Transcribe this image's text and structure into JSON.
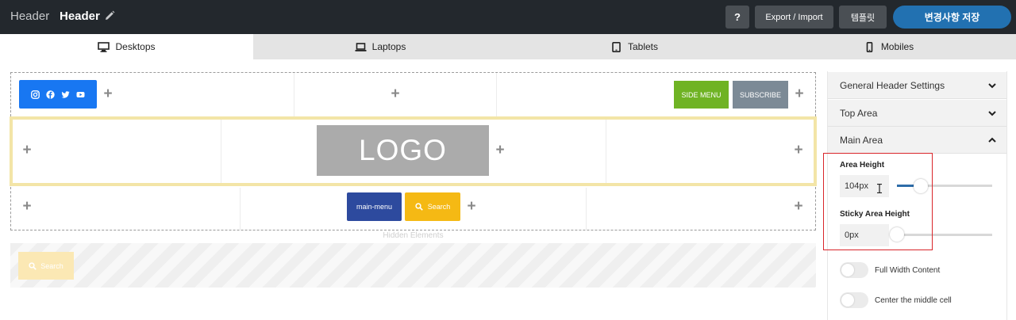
{
  "topbar": {
    "breadcrumb": "Header",
    "title": "Header",
    "help_label": "?",
    "export_label": "Export / Import",
    "template_label": "템플릿",
    "save_label": "변경사항 저장"
  },
  "device_tabs": [
    {
      "label": "Desktops",
      "icon": "desktop-icon",
      "active": true
    },
    {
      "label": "Laptops",
      "icon": "laptop-icon",
      "active": false
    },
    {
      "label": "Tablets",
      "icon": "tablet-icon",
      "active": false
    },
    {
      "label": "Mobiles",
      "icon": "mobile-icon",
      "active": false
    }
  ],
  "builder": {
    "top_row": {
      "social_icons": [
        "instagram-icon",
        "facebook-icon",
        "twitter-icon",
        "youtube-icon"
      ],
      "side_menu_label": "SIDE MENU",
      "subscribe_label": "SUBSCRIBE"
    },
    "main_row": {
      "logo_label": "LOGO"
    },
    "bottom_row": {
      "menu_label": "main-menu",
      "search_label": "Search"
    },
    "hidden_elements_label": "Hidden Elements",
    "hidden_search_label": "Search"
  },
  "panel": {
    "sections": [
      {
        "label": "General Header Settings",
        "expanded": false
      },
      {
        "label": "Top Area",
        "expanded": false
      },
      {
        "label": "Main Area",
        "expanded": true
      }
    ],
    "area_height": {
      "label": "Area Height",
      "value": "104px",
      "slider_fraction": 0.25
    },
    "sticky_area_height": {
      "label": "Sticky Area Height",
      "value": "0px",
      "slider_fraction": 0.0
    },
    "toggles": [
      {
        "label": "Full Width Content",
        "on": false
      },
      {
        "label": "Center the middle cell",
        "on": false
      }
    ]
  },
  "colors": {
    "topbar_bg": "#23282d",
    "save_button": "#2271b1",
    "social_bg": "#1877f2",
    "side_menu_bg": "#6fb324",
    "subscribe_bg": "#7c8a96",
    "menu_bg": "#2d4a9e",
    "search_bg": "#f5b914",
    "main_row_border": "#f3e5a7",
    "highlight_border": "#d9252a"
  }
}
